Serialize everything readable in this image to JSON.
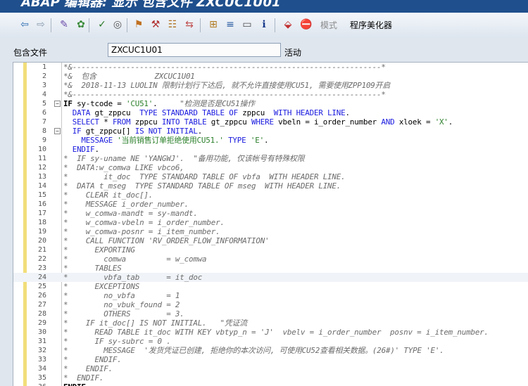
{
  "window": {
    "title": "ABAP 编辑器: 显示 包含文件 ZXCUC1U01"
  },
  "toolbar": {
    "buttons": [
      {
        "name": "back-icon",
        "glyph": "⇦",
        "color": "#2b6cb0"
      },
      {
        "name": "forward-icon",
        "glyph": "⇨",
        "color": "#8a9bb0"
      },
      {
        "name": "display-change-icon",
        "glyph": "✎",
        "color": "#6a4aa8"
      },
      {
        "name": "active-inactive-icon",
        "glyph": "✿",
        "color": "#3a8a3a"
      },
      {
        "name": "check-icon",
        "glyph": "✓",
        "color": "#2a7a2a"
      },
      {
        "name": "activate-icon",
        "glyph": "◎",
        "color": "#555555"
      },
      {
        "name": "test-icon",
        "glyph": "⚑",
        "color": "#c07020"
      },
      {
        "name": "where-used-icon",
        "glyph": "⚒",
        "color": "#b03030"
      },
      {
        "name": "display-object-list-icon",
        "glyph": "☷",
        "color": "#b07020"
      },
      {
        "name": "navigate-icon",
        "glyph": "⇆",
        "color": "#c05050"
      },
      {
        "name": "hierarchy-icon",
        "glyph": "⊞",
        "color": "#b07a20"
      },
      {
        "name": "pretty-print-icon",
        "glyph": "≡",
        "color": "#2a5aa0"
      },
      {
        "name": "window-icon",
        "glyph": "▭",
        "color": "#4a4a4a"
      },
      {
        "name": "info-icon",
        "glyph": "ℹ",
        "color": "#1a3a8a"
      },
      {
        "name": "pattern-icon",
        "glyph": "⬙",
        "color": "#c03030"
      },
      {
        "name": "stop-icon",
        "glyph": "⛔",
        "color": "#c02020"
      }
    ],
    "mode_label": "模式",
    "pretty_printer_label": "程序美化器"
  },
  "field": {
    "label": "包含文件",
    "value": "ZXCUC1U01",
    "status": "活动"
  },
  "colors": {
    "keyword": "#1a1adf",
    "string": "#2a7f2a",
    "comment": "#6b6b6b",
    "plain": "#000000"
  },
  "code_lines": [
    {
      "n": "1",
      "fold": "",
      "hl": false,
      "segs": [
        {
          "c": "cc",
          "t": "*&---------------------------------------------------------------------*"
        }
      ]
    },
    {
      "n": "2",
      "fold": "",
      "hl": false,
      "segs": [
        {
          "c": "cc",
          "t": "*&  包含             ZXCUC1U01"
        }
      ]
    },
    {
      "n": "3",
      "fold": "",
      "hl": false,
      "segs": [
        {
          "c": "cc",
          "t": "*&  2018-11-13 LUOLIN 限制计划行下达后, 就不允许直接使用CU51, 需要使用ZPP109开启"
        }
      ]
    },
    {
      "n": "4",
      "fold": "",
      "hl": false,
      "segs": [
        {
          "c": "cc",
          "t": "*&---------------------------------------------------------------------*"
        }
      ]
    },
    {
      "n": "5",
      "fold": "−",
      "hl": false,
      "segs": [
        {
          "c": "cb",
          "t": "IF"
        },
        {
          "c": "cv",
          "t": " sy-tcode = "
        },
        {
          "c": "cs",
          "t": "'CU51'"
        },
        {
          "c": "cv",
          "t": ".     "
        },
        {
          "c": "cc",
          "t": "\"检测是否是CU51操作"
        }
      ]
    },
    {
      "n": "6",
      "fold": "",
      "hl": false,
      "segs": [
        {
          "c": "ck",
          "t": "  DATA"
        },
        {
          "c": "cv",
          "t": " gt_zppcu  "
        },
        {
          "c": "ck",
          "t": "TYPE STANDARD TABLE OF"
        },
        {
          "c": "cv",
          "t": " zppcu  "
        },
        {
          "c": "ck",
          "t": "WITH HEADER LINE"
        },
        {
          "c": "cv",
          "t": "."
        }
      ]
    },
    {
      "n": "7",
      "fold": "",
      "hl": false,
      "segs": [
        {
          "c": "ck",
          "t": "  SELECT"
        },
        {
          "c": "cv",
          "t": " * "
        },
        {
          "c": "ck",
          "t": "FROM"
        },
        {
          "c": "cv",
          "t": " zppcu "
        },
        {
          "c": "ck",
          "t": "INTO TABLE"
        },
        {
          "c": "cv",
          "t": " gt_zppcu "
        },
        {
          "c": "ck",
          "t": "WHERE"
        },
        {
          "c": "cv",
          "t": " vbeln = i_order_number "
        },
        {
          "c": "ck",
          "t": "AND"
        },
        {
          "c": "cv",
          "t": " xloek = "
        },
        {
          "c": "cs",
          "t": "'X'"
        },
        {
          "c": "cv",
          "t": "."
        }
      ]
    },
    {
      "n": "8",
      "fold": "−",
      "hl": false,
      "segs": [
        {
          "c": "ck",
          "t": "  IF"
        },
        {
          "c": "cv",
          "t": " gt_zppcu[] "
        },
        {
          "c": "ck",
          "t": "IS NOT INITIAL"
        },
        {
          "c": "cv",
          "t": "."
        }
      ]
    },
    {
      "n": "9",
      "fold": "",
      "hl": false,
      "segs": [
        {
          "c": "ck",
          "t": "    MESSAGE"
        },
        {
          "c": "cv",
          "t": " "
        },
        {
          "c": "cs",
          "t": "'当前销售订单拒绝使用CU51.'"
        },
        {
          "c": "cv",
          "t": " "
        },
        {
          "c": "ck",
          "t": "TYPE"
        },
        {
          "c": "cv",
          "t": " "
        },
        {
          "c": "cs",
          "t": "'E'"
        },
        {
          "c": "cv",
          "t": "."
        }
      ]
    },
    {
      "n": "10",
      "fold": "",
      "hl": false,
      "segs": [
        {
          "c": "ck",
          "t": "  ENDIF"
        },
        {
          "c": "cv",
          "t": "."
        }
      ]
    },
    {
      "n": "11",
      "fold": "",
      "hl": false,
      "segs": [
        {
          "c": "cc",
          "t": "*  IF sy-uname NE 'YANGWJ'.  \"备用功能, 仅该帐号有特殊权限"
        }
      ]
    },
    {
      "n": "12",
      "fold": "",
      "hl": false,
      "segs": [
        {
          "c": "cc",
          "t": "*  DATA:w_comwa LIKE vbco6,"
        }
      ]
    },
    {
      "n": "13",
      "fold": "",
      "hl": false,
      "segs": [
        {
          "c": "cc",
          "t": "*        it_doc  TYPE STANDARD TABLE OF vbfa  WITH HEADER LINE."
        }
      ]
    },
    {
      "n": "14",
      "fold": "",
      "hl": false,
      "segs": [
        {
          "c": "cc",
          "t": "*  DATA t_mseg  TYPE STANDARD TABLE OF mseg  WITH HEADER LINE."
        }
      ]
    },
    {
      "n": "15",
      "fold": "",
      "hl": false,
      "segs": [
        {
          "c": "cc",
          "t": "*    CLEAR it_doc[]."
        }
      ]
    },
    {
      "n": "16",
      "fold": "",
      "hl": false,
      "segs": [
        {
          "c": "cc",
          "t": "*    MESSAGE i_order_number."
        }
      ]
    },
    {
      "n": "17",
      "fold": "",
      "hl": false,
      "segs": [
        {
          "c": "cc",
          "t": "*    w_comwa-mandt = sy-mandt."
        }
      ]
    },
    {
      "n": "18",
      "fold": "",
      "hl": false,
      "segs": [
        {
          "c": "cc",
          "t": "*    w_comwa-vbeln = i_order_number."
        }
      ]
    },
    {
      "n": "19",
      "fold": "",
      "hl": false,
      "segs": [
        {
          "c": "cc",
          "t": "*    w_comwa-posnr = i_item_number."
        }
      ]
    },
    {
      "n": "20",
      "fold": "",
      "hl": false,
      "segs": [
        {
          "c": "cc",
          "t": "*    CALL FUNCTION 'RV_ORDER_FLOW_INFORMATION'"
        }
      ]
    },
    {
      "n": "21",
      "fold": "",
      "hl": false,
      "segs": [
        {
          "c": "cc",
          "t": "*      EXPORTING"
        }
      ]
    },
    {
      "n": "22",
      "fold": "",
      "hl": false,
      "segs": [
        {
          "c": "cc",
          "t": "*        comwa         = w_comwa"
        }
      ]
    },
    {
      "n": "23",
      "fold": "",
      "hl": false,
      "segs": [
        {
          "c": "cc",
          "t": "*      TABLES"
        }
      ]
    },
    {
      "n": "24",
      "fold": "",
      "hl": true,
      "segs": [
        {
          "c": "cc",
          "t": "*        vbfa_tab      = it_doc"
        }
      ]
    },
    {
      "n": "25",
      "fold": "",
      "hl": false,
      "segs": [
        {
          "c": "cc",
          "t": "*      EXCEPTIONS"
        }
      ]
    },
    {
      "n": "26",
      "fold": "",
      "hl": false,
      "segs": [
        {
          "c": "cc",
          "t": "*        no_vbfa       = 1"
        }
      ]
    },
    {
      "n": "27",
      "fold": "",
      "hl": false,
      "segs": [
        {
          "c": "cc",
          "t": "*        no_vbuk_found = 2"
        }
      ]
    },
    {
      "n": "28",
      "fold": "",
      "hl": false,
      "segs": [
        {
          "c": "cc",
          "t": "*        OTHERS        = 3."
        }
      ]
    },
    {
      "n": "29",
      "fold": "",
      "hl": false,
      "segs": [
        {
          "c": "cc",
          "t": "*    IF it_doc[] IS NOT INITIAL.   \"凭证流"
        }
      ]
    },
    {
      "n": "30",
      "fold": "",
      "hl": false,
      "segs": [
        {
          "c": "cc",
          "t": "*      READ TABLE it_doc WITH KEY vbtyp_n = 'J'  vbelv = i_order_number  posnv = i_item_number."
        }
      ]
    },
    {
      "n": "31",
      "fold": "",
      "hl": false,
      "segs": [
        {
          "c": "cc",
          "t": "*      IF sy-subrc = 0 ."
        }
      ]
    },
    {
      "n": "32",
      "fold": "",
      "hl": false,
      "segs": [
        {
          "c": "cc",
          "t": "*        MESSAGE  '发货凭证已创建, 拒绝你的本次访问, 可使用CU52查看相关数据。(26#)' TYPE 'E'."
        }
      ]
    },
    {
      "n": "33",
      "fold": "",
      "hl": false,
      "segs": [
        {
          "c": "cc",
          "t": "*      ENDIF."
        }
      ]
    },
    {
      "n": "34",
      "fold": "",
      "hl": false,
      "segs": [
        {
          "c": "cc",
          "t": "*    ENDIF."
        }
      ]
    },
    {
      "n": "35",
      "fold": "",
      "hl": false,
      "segs": [
        {
          "c": "cc",
          "t": "*  ENDIF."
        }
      ]
    },
    {
      "n": "36",
      "fold": "",
      "hl": false,
      "segs": [
        {
          "c": "cb",
          "t": "ENDIF"
        },
        {
          "c": "cv",
          "t": "."
        }
      ]
    }
  ]
}
